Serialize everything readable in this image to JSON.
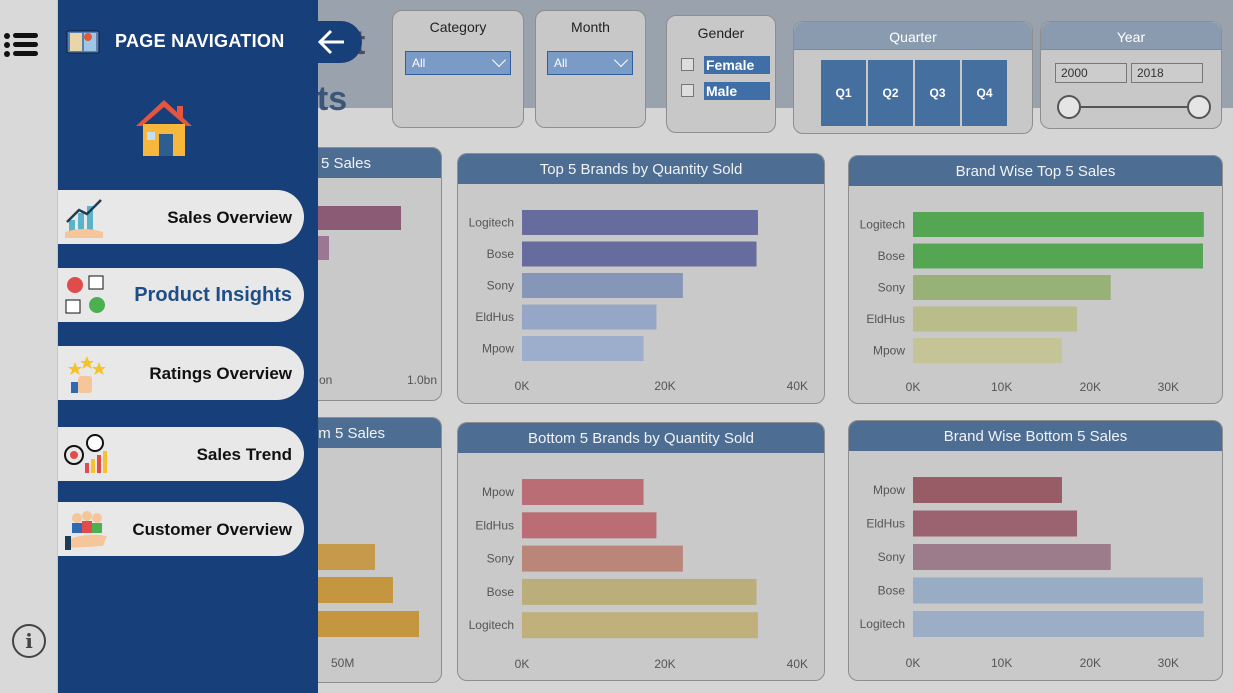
{
  "header": {
    "title_fragment": "sts",
    "title_glyph": "t"
  },
  "navigation": {
    "title": "PAGE NAVIGATION",
    "items": [
      {
        "label": "Sales Overview",
        "active": false
      },
      {
        "label": "Product Insights",
        "active": true
      },
      {
        "label": "Ratings Overview",
        "active": false
      },
      {
        "label": "Sales Trend",
        "active": false
      },
      {
        "label": "Customer Overview",
        "active": false
      }
    ]
  },
  "filters": {
    "category": {
      "label": "Category",
      "value": "All"
    },
    "month": {
      "label": "Month",
      "value": "All"
    },
    "gender": {
      "label": "Gender",
      "options": [
        "Female",
        "Male"
      ]
    },
    "quarter": {
      "label": "Quarter",
      "options": [
        "Q1",
        "Q2",
        "Q3",
        "Q4"
      ]
    },
    "year": {
      "label": "Year",
      "from": "2000",
      "to": "2018"
    }
  },
  "cards": {
    "partial_top_title": "5 Sales",
    "partial_top_ticks": [
      "on",
      "1.0bn"
    ],
    "partial_bottom_title": "m 5 Sales",
    "partial_bottom_ticks": [
      "50M"
    ]
  },
  "colors": {
    "nav_bg": "#173f79",
    "card_header": "#4d6d92",
    "slicer_active": "#456f9f"
  },
  "chart_data": [
    {
      "type": "bar",
      "orientation": "horizontal",
      "title": "Top 5 Brands by Quantity Sold",
      "categories": [
        "Logitech",
        "Bose",
        "Sony",
        "EldHus",
        "Mpow"
      ],
      "values": [
        33000,
        32800,
        22500,
        18800,
        17000
      ],
      "xlim": [
        0,
        40000
      ],
      "xticks": [
        "0K",
        "20K",
        "40K"
      ],
      "colors": [
        "#676c9e",
        "#676c9e",
        "#8696b8",
        "#95a6c6",
        "#9caecb"
      ]
    },
    {
      "type": "bar",
      "orientation": "horizontal",
      "title": "Brand Wise Top 5 Sales",
      "categories": [
        "Logitech",
        "Bose",
        "Sony",
        "EldHus",
        "Mpow"
      ],
      "values": [
        32800,
        32700,
        22300,
        18500,
        16800
      ],
      "xlim": [
        0,
        30000
      ],
      "xticks": [
        "0K",
        "10K",
        "20K",
        "30K"
      ],
      "colors": [
        "#54a653",
        "#54a653",
        "#98b176",
        "#b8bd8a",
        "#c5c497"
      ]
    },
    {
      "type": "bar",
      "orientation": "horizontal",
      "title": "Bottom 5 Brands by Quantity Sold",
      "categories": [
        "Mpow",
        "EldHus",
        "Sony",
        "Bose",
        "Logitech"
      ],
      "values": [
        17000,
        18800,
        22500,
        32800,
        33000
      ],
      "xlim": [
        0,
        40000
      ],
      "xticks": [
        "0K",
        "20K",
        "40K"
      ],
      "colors": [
        "#ba6d74",
        "#ba6d74",
        "#b98679",
        "#baae7b",
        "#c0b07c"
      ]
    },
    {
      "type": "bar",
      "orientation": "horizontal",
      "title": "Brand Wise Bottom 5 Sales",
      "categories": [
        "Mpow",
        "EldHus",
        "Sony",
        "Bose",
        "Logitech"
      ],
      "values": [
        16800,
        18500,
        22300,
        32700,
        32800
      ],
      "xlim": [
        0,
        30000
      ],
      "xticks": [
        "0K",
        "10K",
        "20K",
        "30K"
      ],
      "colors": [
        "#975c66",
        "#9b6270",
        "#9c7c8a",
        "#98acc4",
        "#9caec6"
      ]
    }
  ]
}
